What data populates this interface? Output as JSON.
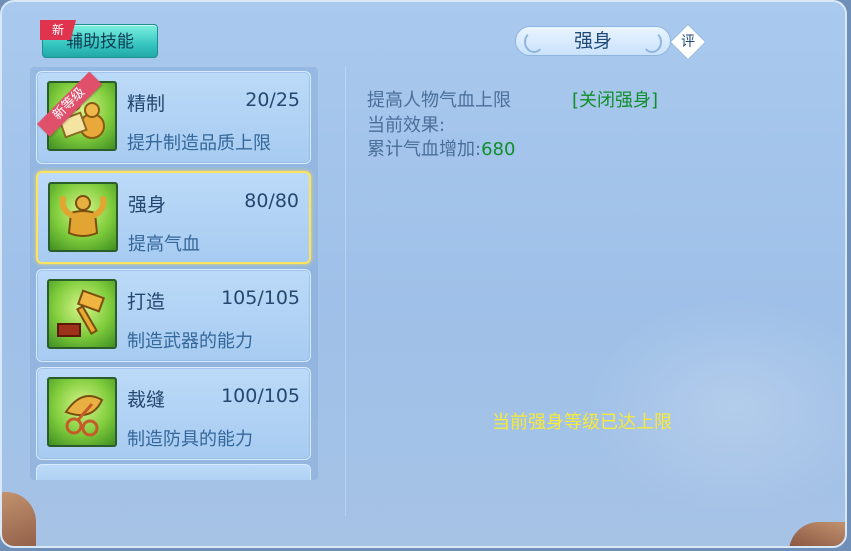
{
  "category_tab": {
    "label": "辅助技能",
    "new_flag": "新"
  },
  "skills": [
    {
      "name": "精制",
      "level": "20/25",
      "desc": "提升制造品质上限",
      "badge": "新等级",
      "icon": "gourd-scroll-icon"
    },
    {
      "name": "强身",
      "level": "80/80",
      "desc": "提高气血",
      "icon": "strongman-icon"
    },
    {
      "name": "打造",
      "level": "105/105",
      "desc": "制造武器的能力",
      "icon": "hammer-icon"
    },
    {
      "name": "裁缝",
      "level": "100/105",
      "desc": "制造防具的能力",
      "icon": "scissors-leaf-icon"
    }
  ],
  "detail": {
    "title": "强身",
    "rate_label": "评",
    "effect_desc": "提高人物气血上限",
    "toggle_label": "[关闭强身]",
    "current_effect_label": "当前效果:",
    "cumulative_label": "累计气血增加:",
    "cumulative_value": "680",
    "max_notice": "当前强身等级已达上限"
  },
  "colors": {
    "accent_green": "#0f8f2a",
    "notice_yellow": "#f7ea3a",
    "selected_border": "#ffe35a",
    "tab_teal": "#36c6c0"
  }
}
